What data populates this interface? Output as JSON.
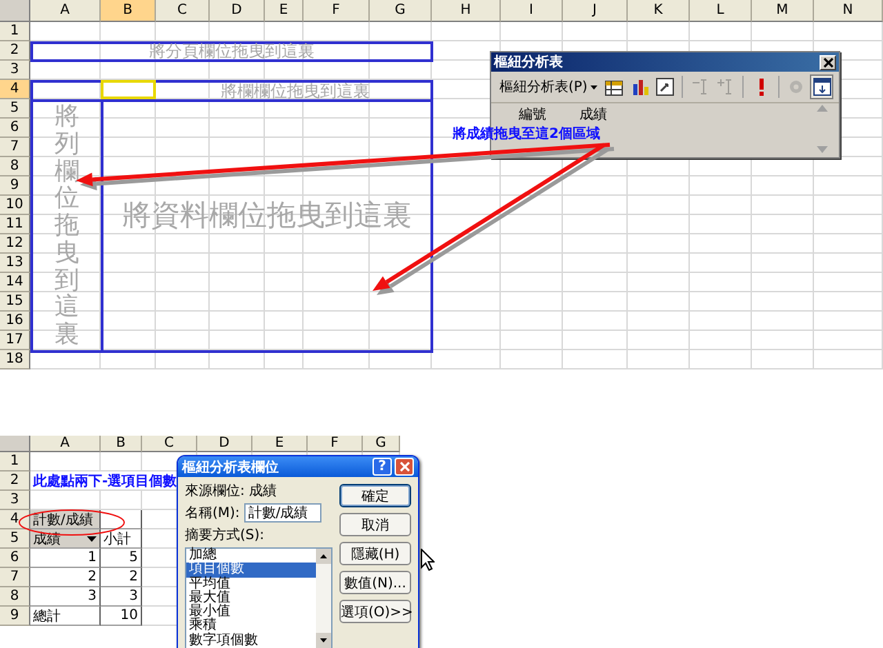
{
  "top_sheet": {
    "columns": [
      {
        "label": "A",
        "selected": false
      },
      {
        "label": "B",
        "selected": true
      },
      {
        "label": "C",
        "selected": false
      },
      {
        "label": "D",
        "selected": false
      },
      {
        "label": "E",
        "selected": false
      },
      {
        "label": "F",
        "selected": false
      },
      {
        "label": "G",
        "selected": false
      },
      {
        "label": "H",
        "selected": false
      },
      {
        "label": "I",
        "selected": false
      },
      {
        "label": "J",
        "selected": false
      },
      {
        "label": "K",
        "selected": false
      },
      {
        "label": "L",
        "selected": false
      },
      {
        "label": "M",
        "selected": false
      },
      {
        "label": "N",
        "selected": false
      }
    ],
    "rows": [
      {
        "label": "1",
        "selected": false
      },
      {
        "label": "2",
        "selected": false
      },
      {
        "label": "3",
        "selected": false
      },
      {
        "label": "4",
        "selected": true
      },
      {
        "label": "5",
        "selected": false
      },
      {
        "label": "6",
        "selected": false
      },
      {
        "label": "7",
        "selected": false
      },
      {
        "label": "8",
        "selected": false
      },
      {
        "label": "9",
        "selected": false
      },
      {
        "label": "10",
        "selected": false
      },
      {
        "label": "11",
        "selected": false
      },
      {
        "label": "12",
        "selected": false
      },
      {
        "label": "13",
        "selected": false
      },
      {
        "label": "14",
        "selected": false
      },
      {
        "label": "15",
        "selected": false
      },
      {
        "label": "16",
        "selected": false
      },
      {
        "label": "17",
        "selected": false
      },
      {
        "label": "18",
        "selected": false
      }
    ],
    "drop_zones": [
      {
        "kind": "page",
        "text": "將分頁欄位拖曳到這裏"
      },
      {
        "kind": "column",
        "text": "將欄欄位拖曳到這裏"
      },
      {
        "kind": "row",
        "text": "將列欄位拖曳到這裏"
      },
      {
        "kind": "data",
        "text": "將資料欄位拖曳到這裏"
      }
    ]
  },
  "pivot_toolbar": {
    "title": "樞紐分析表",
    "menu": "樞紐分析表(P)",
    "tools": [
      {
        "kind": "format",
        "disabled": false,
        "selected": false
      },
      {
        "kind": "chart",
        "disabled": false,
        "selected": false
      },
      {
        "kind": "wizard",
        "disabled": false,
        "selected": false
      },
      {
        "kind": "hide_detail",
        "disabled": true,
        "selected": false
      },
      {
        "kind": "show_detail",
        "disabled": true,
        "selected": false
      },
      {
        "kind": "refresh",
        "disabled": false,
        "selected": false
      },
      {
        "kind": "settings",
        "disabled": true,
        "selected": false
      },
      {
        "kind": "field_list",
        "disabled": false,
        "selected": true
      }
    ],
    "fields": [
      "編號",
      "成績"
    ]
  },
  "annotation": "將成績拖曳至這2個區域",
  "bottom_sheet": {
    "columns": [
      "A",
      "B",
      "C",
      "D",
      "E",
      "F",
      "G"
    ],
    "rows": [
      {
        "label": "1",
        "cells": []
      },
      {
        "label": "2",
        "cells": [
          {
            "kind": "note",
            "text": "此處點兩下-選項目個數"
          }
        ]
      },
      {
        "label": "3",
        "cells": []
      },
      {
        "label": "4",
        "cells": [
          {
            "kind": "field",
            "text": "計數/成績"
          }
        ]
      },
      {
        "label": "5",
        "cells": [
          {
            "kind": "dropdown",
            "text": "成績"
          },
          {
            "kind": "text",
            "text": "小計"
          }
        ]
      },
      {
        "label": "6",
        "cells": [
          {
            "kind": "number",
            "text": "1"
          },
          {
            "kind": "number",
            "text": "5"
          }
        ]
      },
      {
        "label": "7",
        "cells": [
          {
            "kind": "number",
            "text": "2"
          },
          {
            "kind": "number",
            "text": "2"
          }
        ]
      },
      {
        "label": "8",
        "cells": [
          {
            "kind": "number",
            "text": "3"
          },
          {
            "kind": "number",
            "text": "3"
          }
        ]
      },
      {
        "label": "9",
        "cells": [
          {
            "kind": "text",
            "text": "總計"
          },
          {
            "kind": "number",
            "text": "10"
          }
        ]
      }
    ]
  },
  "dialog": {
    "title": "樞紐分析表欄位",
    "help": "?",
    "source": "來源欄位: 成績",
    "name_label": "名稱(M):",
    "name_value": "計數/成績",
    "summary_label": "摘要方式(S):",
    "summary_options": [
      {
        "label": "加總",
        "selected": false
      },
      {
        "label": "項目個數",
        "selected": true
      },
      {
        "label": "平均值",
        "selected": false
      },
      {
        "label": "最大值",
        "selected": false
      },
      {
        "label": "最小值",
        "selected": false
      },
      {
        "label": "乘積",
        "selected": false
      },
      {
        "label": "數字項個數",
        "selected": false
      }
    ],
    "buttons": [
      {
        "label": "確定",
        "default": true
      },
      {
        "label": "取消",
        "default": false
      },
      {
        "label": "隱藏(H)",
        "default": false
      },
      {
        "label": "數值(N)...",
        "default": false
      },
      {
        "label": "選項(O)>>",
        "default": false
      }
    ]
  }
}
